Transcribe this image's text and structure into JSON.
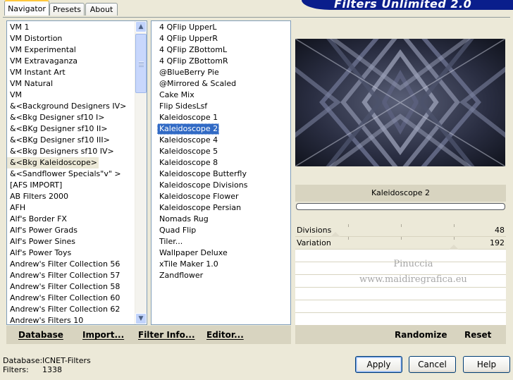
{
  "banner": {
    "title": "Filters Unlimited 2.0"
  },
  "tabs": [
    {
      "label": "Navigator"
    },
    {
      "label": "Presets"
    },
    {
      "label": "About"
    }
  ],
  "categories": {
    "items": [
      "VM 1",
      "VM Distortion",
      "VM Experimental",
      "VM Extravaganza",
      "VM Instant Art",
      "VM Natural",
      "VM",
      "&<Background Designers IV>",
      "&<Bkg Designer sf10 I>",
      "&<BKg Designer sf10 II>",
      "&<BKg Designer sf10 III>",
      "&<Bkg Designers sf10 IV>",
      "&<Bkg Kaleidoscope>",
      "&<Sandflower Specials\"v\" >",
      "[AFS IMPORT]",
      "AB Filters 2000",
      "AFH",
      "Alf's Border FX",
      "Alf's Power Grads",
      "Alf's Power Sines",
      "Alf's Power Toys",
      "Andrew's Filter Collection 56",
      "Andrew's Filter Collection 57",
      "Andrew's Filter Collection 58",
      "Andrew's Filter Collection 60",
      "Andrew's Filter Collection 62",
      "Andrew's Filters 10"
    ],
    "selected_index": 12
  },
  "filters": {
    "items": [
      "4 QFlip UpperL",
      "4 QFlip UpperR",
      "4 QFlip ZBottomL",
      "4 QFlip ZBottomR",
      "@BlueBerry Pie",
      "@Mirrored & Scaled",
      "Cake Mix",
      "Flip SidesLsf",
      "Kaleidoscope 1",
      "Kaleidoscope 2",
      "Kaleidoscope 4",
      "Kaleidoscope 5",
      "Kaleidoscope 8",
      "Kaleidoscope Butterfly",
      "Kaleidoscope Divisions",
      "Kaleidoscope Flower",
      "Kaleidoscope Persian",
      "Nomads Rug",
      "Quad Flip",
      "Tiler...",
      "Wallpaper Deluxe",
      "xTile Maker 1.0",
      "Zandflower"
    ],
    "selected_index": 9
  },
  "bottom_buttons": {
    "database": "Database",
    "import": "Import...",
    "filter_info": "Filter Info...",
    "editor": "Editor...",
    "randomize": "Randomize",
    "reset": "Reset"
  },
  "preview": {
    "filter_name": "Kaleidoscope 2",
    "progress": 0
  },
  "params": [
    {
      "name": "Divisions",
      "value": "48"
    },
    {
      "name": "Variation",
      "value": "192"
    }
  ],
  "watermark": {
    "line1": "Pinuccia",
    "line2": "www.maidiregrafica.eu"
  },
  "status": {
    "database_label": "Database:",
    "database_value": "ICNET-Filters",
    "filters_label": "Filters:",
    "filters_value": "1338"
  },
  "dialog_buttons": {
    "apply": "Apply",
    "cancel": "Cancel",
    "help": "Help"
  },
  "colors": {
    "selection": "#316ac5",
    "banner": "#0a1e8c",
    "preview_bg": "#1c2030"
  }
}
